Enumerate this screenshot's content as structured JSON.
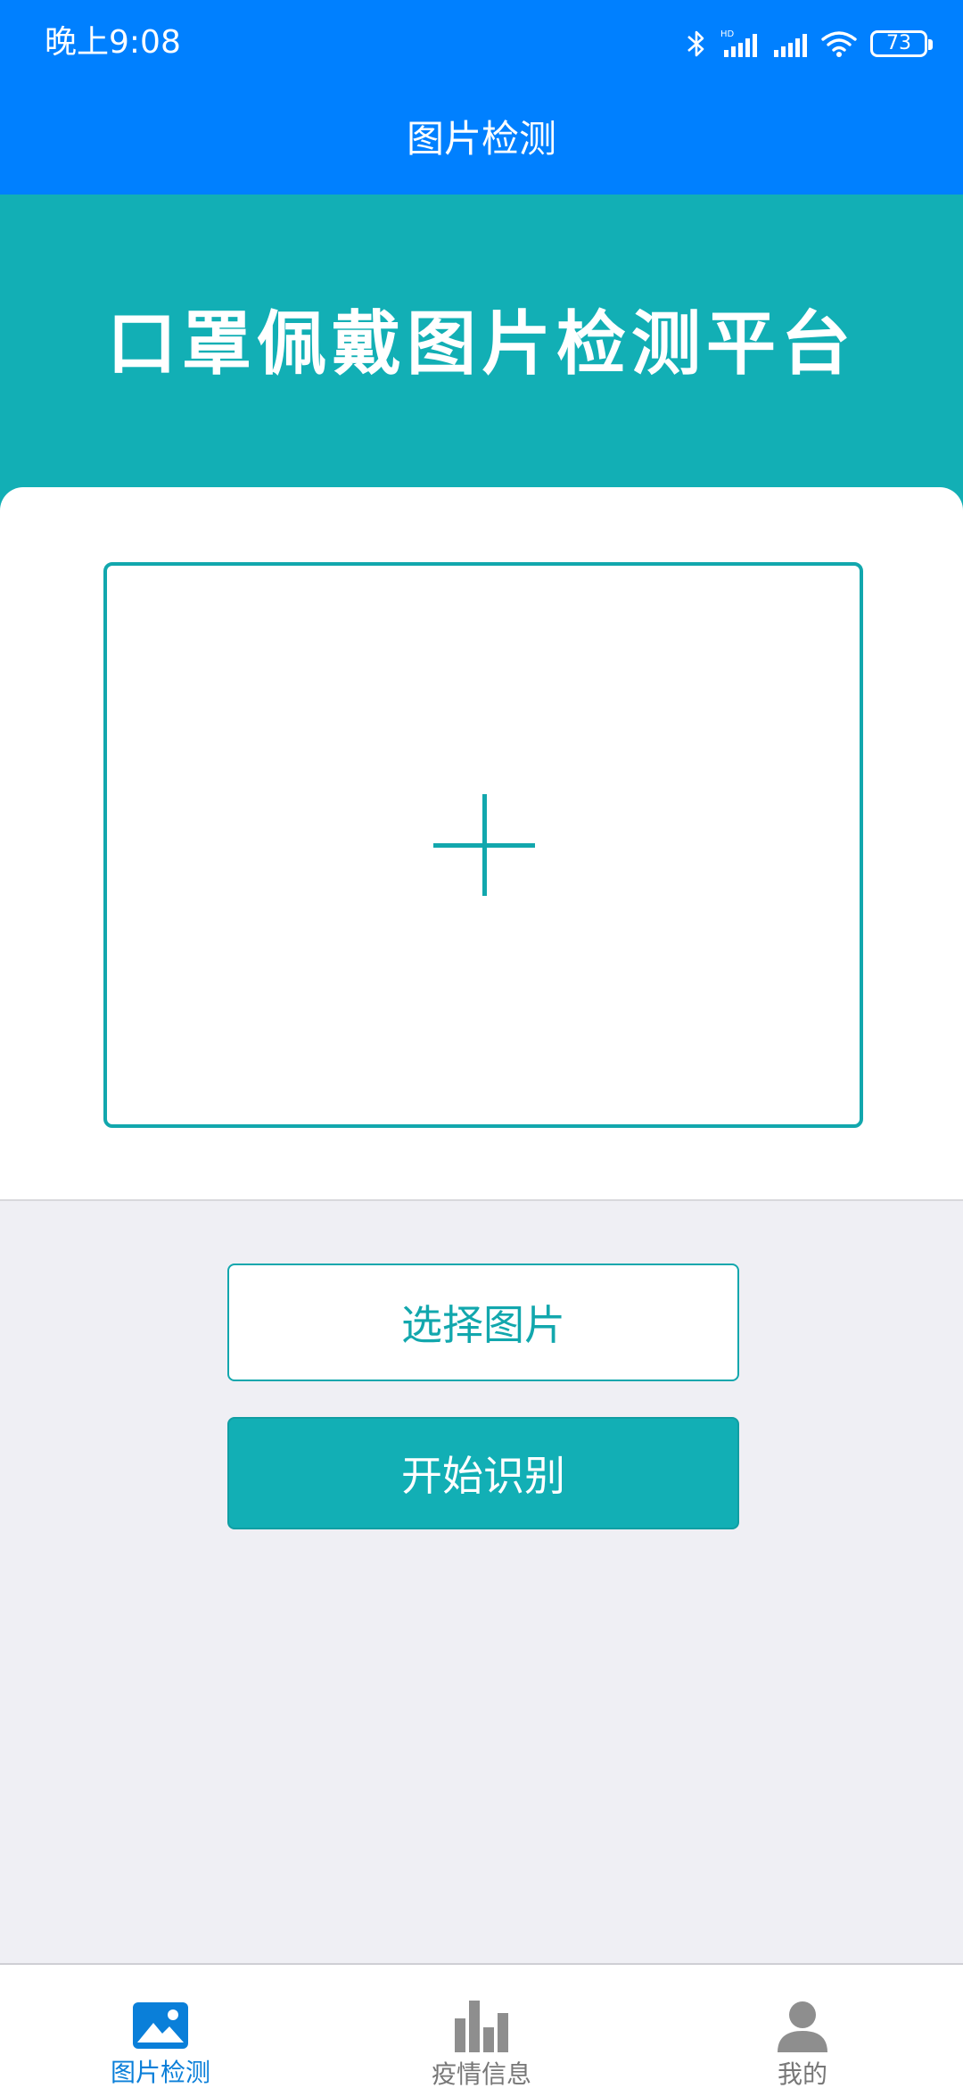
{
  "status_bar": {
    "time": "晚上9:08",
    "network_tag": "HD",
    "battery": "73",
    "icons": [
      "bluetooth-icon",
      "signal-icon",
      "signal-icon",
      "wifi-icon",
      "battery-icon"
    ]
  },
  "nav": {
    "title": "图片检测"
  },
  "banner": {
    "title": "口罩佩戴图片检测平台"
  },
  "upload": {
    "icon": "plus-icon"
  },
  "buttons": {
    "select": "选择图片",
    "start": "开始识别"
  },
  "tabbar": {
    "items": [
      {
        "label": "图片检测",
        "icon": "image-icon",
        "active": true
      },
      {
        "label": "疫情信息",
        "icon": "bar-chart-icon",
        "active": false
      },
      {
        "label": "我的",
        "icon": "user-icon",
        "active": false
      }
    ]
  },
  "colors": {
    "nav_blue": "#0080ff",
    "teal": "#12afb5",
    "background": "#efeff4",
    "tab_active": "#0a7fd9",
    "tab_inactive": "#777777"
  }
}
